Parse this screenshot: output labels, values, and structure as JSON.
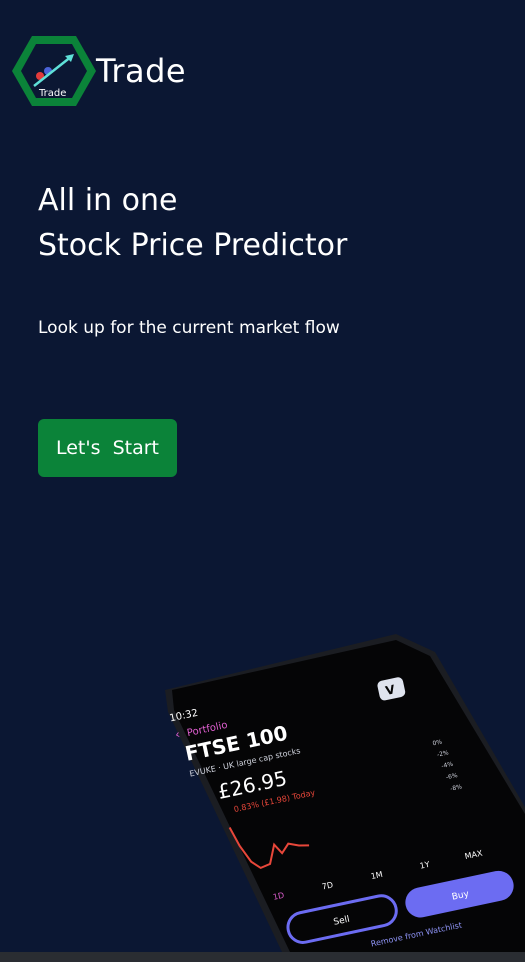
{
  "header": {
    "logo_text": "Trade",
    "brand": "Trade"
  },
  "hero": {
    "title_line1": "All in one",
    "title_line2": "Stock Price Predictor",
    "subtitle": "Look up for the current market flow",
    "cta_label": "Let's  Start"
  },
  "phone": {
    "time": "10:32",
    "back_link": "Portfolio",
    "index_name": "FTSE 100",
    "index_desc": "EVUKE · UK large cap stocks",
    "price": "£26.95",
    "change": "0.83% (£1.98) Today",
    "ranges": [
      "1D",
      "7D",
      "1M",
      "1Y",
      "MAX"
    ],
    "scale": [
      "0%",
      "-2%",
      "-4%",
      "-6%",
      "-8%"
    ],
    "sell_label": "Sell",
    "buy_label": "Buy",
    "watchlist": "Remove from Watchlist",
    "app_badge": "V"
  },
  "colors": {
    "background": "#0b1733",
    "cta": "#0b8339",
    "logo_green": "#0b8339",
    "chart_red": "#e8473a",
    "buy_purple": "#6c6cf2",
    "accent_pink": "#e05fd0"
  }
}
